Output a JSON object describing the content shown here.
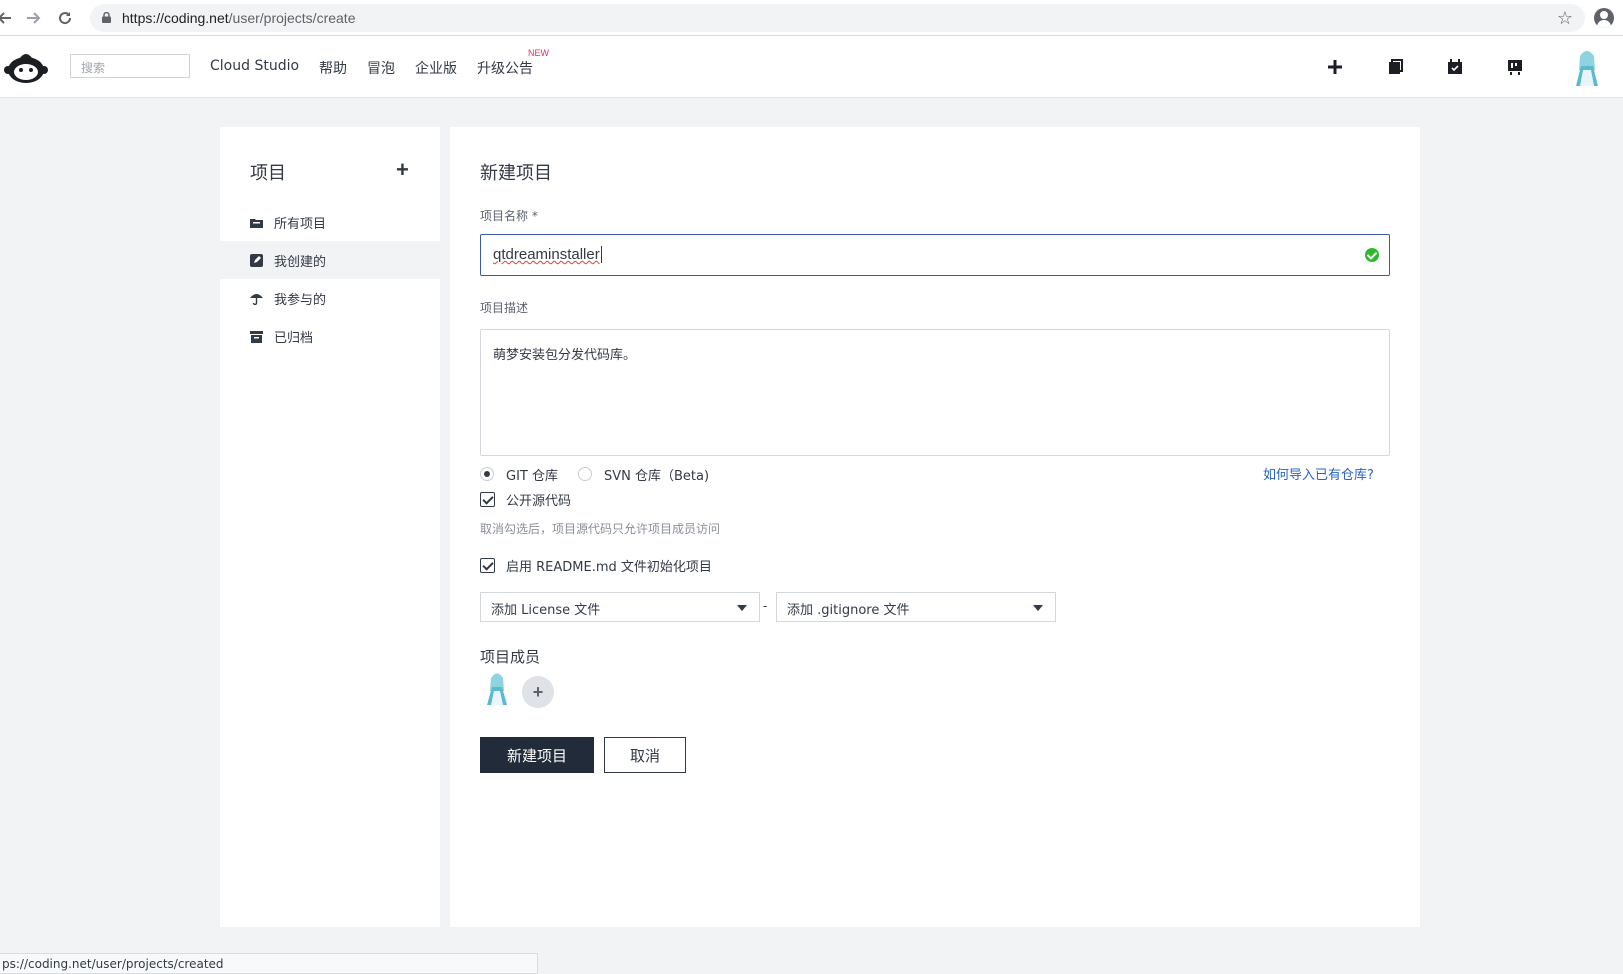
{
  "browser": {
    "url_host": "https://coding.net",
    "url_path": "/user/projects/create",
    "status_url": "ps://coding.net/user/projects/created"
  },
  "header": {
    "search_placeholder": "搜索",
    "nav": [
      "Cloud Studio",
      "帮助",
      "冒泡",
      "企业版",
      "升级公告"
    ],
    "new_badge": "NEW",
    "icons": [
      "plus-icon",
      "notebook-icon",
      "calendar-check-icon",
      "board-icon"
    ]
  },
  "sidebar": {
    "title": "项目",
    "add": "+",
    "items": [
      {
        "label": "所有项目",
        "icon": "folder-icon"
      },
      {
        "label": "我创建的",
        "icon": "edit-icon",
        "active": true
      },
      {
        "label": "我参与的",
        "icon": "umbrella-icon"
      },
      {
        "label": "已归档",
        "icon": "archive-icon"
      }
    ]
  },
  "form": {
    "title": "新建项目",
    "name_label": "项目名称 *",
    "name_value": "qtdreaminstaller",
    "desc_label": "项目描述",
    "desc_value": "萌梦安装包分发代码库。",
    "repo_git": "GIT 仓库",
    "repo_svn": "SVN 仓库（Beta)",
    "repo_selected": "git",
    "import_help": "如何导入已有仓库?",
    "public_label": "公开源代码",
    "public_checked": true,
    "public_hint": "取消勾选后，项目源代码只允许项目成员访问",
    "readme_label": "启用 README.md 文件初始化项目",
    "readme_checked": true,
    "license_select": "添加 License 文件",
    "separator": "-",
    "gitignore_select": "添加 .gitignore 文件",
    "members_title": "项目成员",
    "add_member": "+",
    "submit": "新建项目",
    "cancel": "取消"
  },
  "colors": {
    "primary_button": "#212b3a",
    "link": "#2962c4",
    "valid": "#2eb82e",
    "focus_border": "#3b5aa6",
    "page_bg": "#f2f3f5"
  }
}
